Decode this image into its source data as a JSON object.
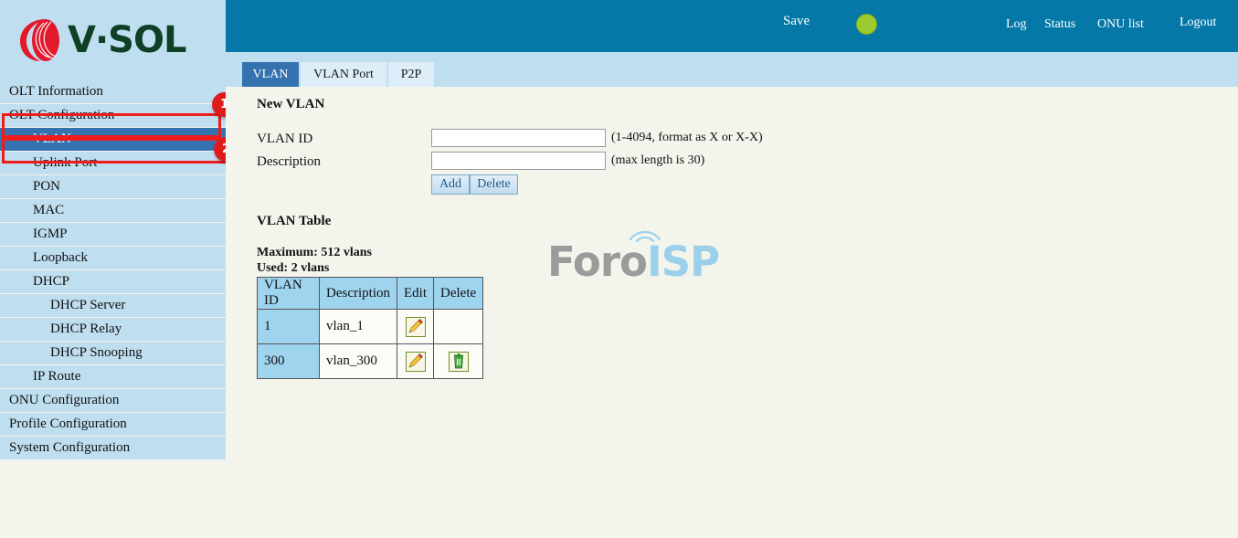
{
  "brand": {
    "logo_text": "V·SOL",
    "logo_mark": "vsol-swirl-logo",
    "logo_color": "#0d4025",
    "mark_color": "#e2182b"
  },
  "topbar": {
    "background": "#0578a8",
    "save_label": "Save",
    "status_indicator": {
      "name": "status-dot",
      "color": "#9ccb2f"
    },
    "links": [
      {
        "label": "Log",
        "name": "log"
      },
      {
        "label": "Status",
        "name": "status"
      },
      {
        "label": "ONU list",
        "name": "onu-list"
      },
      {
        "label": "Logout",
        "name": "logout"
      }
    ]
  },
  "tabs": [
    {
      "label": "VLAN",
      "active": true
    },
    {
      "label": "VLAN Port",
      "active": false
    },
    {
      "label": "P2P",
      "active": false
    }
  ],
  "sidebar": {
    "items": [
      {
        "label": "OLT Information",
        "level": 0,
        "active": false
      },
      {
        "label": "OLT Configuration",
        "level": 0,
        "active": false
      },
      {
        "label": "VLAN",
        "level": 1,
        "active": true
      },
      {
        "label": "Uplink Port",
        "level": 1,
        "active": false
      },
      {
        "label": "PON",
        "level": 1,
        "active": false
      },
      {
        "label": "MAC",
        "level": 1,
        "active": false
      },
      {
        "label": "IGMP",
        "level": 1,
        "active": false
      },
      {
        "label": "Loopback",
        "level": 1,
        "active": false
      },
      {
        "label": "DHCP",
        "level": 1,
        "active": false
      },
      {
        "label": "DHCP Server",
        "level": 2,
        "active": false
      },
      {
        "label": "DHCP Relay",
        "level": 2,
        "active": false
      },
      {
        "label": "DHCP Snooping",
        "level": 2,
        "active": false
      },
      {
        "label": "IP Route",
        "level": 1,
        "active": false
      },
      {
        "label": "ONU Configuration",
        "level": 0,
        "active": false
      },
      {
        "label": "Profile Configuration",
        "level": 0,
        "active": false
      },
      {
        "label": "System Configuration",
        "level": 0,
        "active": false
      }
    ]
  },
  "annotations": {
    "color": "#ee1c1c",
    "badges": [
      {
        "number": "1",
        "targets": "OLT Configuration"
      },
      {
        "number": "2",
        "targets": "VLAN"
      }
    ]
  },
  "main": {
    "new_vlan": {
      "title": "New VLAN",
      "vlan_id": {
        "label": "VLAN ID",
        "value": "",
        "placeholder": "",
        "hint": "(1-4094, format as X or X-X)"
      },
      "description": {
        "label": "Description",
        "value": "",
        "placeholder": "",
        "hint": "(max length is 30)"
      },
      "add_label": "Add",
      "delete_label": "Delete"
    },
    "vlan_table": {
      "title": "VLAN Table",
      "maximum": "Maximum: 512 vlans",
      "used": "Used: 2 vlans",
      "columns": [
        "VLAN ID",
        "Description",
        "Edit",
        "Delete"
      ],
      "rows": [
        {
          "id": "1",
          "description": "vlan_1",
          "edit_icon": "pencil-edit-icon",
          "delete_icon": ""
        },
        {
          "id": "300",
          "description": "vlan_300",
          "edit_icon": "pencil-edit-icon",
          "delete_icon": "trash-delete-icon"
        }
      ]
    }
  },
  "watermark": {
    "part1": "Foro",
    "part2": "ISP",
    "part1_color": "#9b9b9b",
    "part2_color": "#9cd0ea"
  }
}
